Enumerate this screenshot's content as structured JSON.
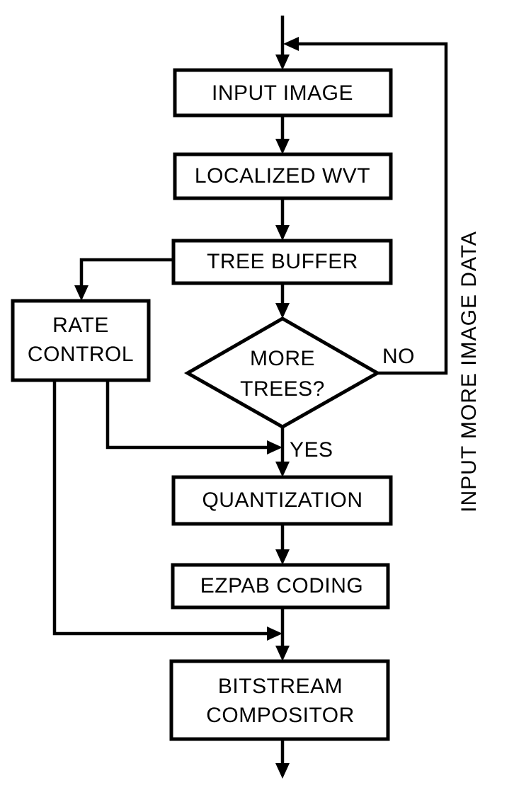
{
  "diagram": {
    "type": "flowchart",
    "title": "Image compression encoder flowchart",
    "orientation": "top-to-bottom",
    "background_color": "#ffffff",
    "line_color": "#000000",
    "nodes": {
      "input_image": {
        "label": "INPUT IMAGE",
        "shape": "rectangle"
      },
      "localized_wvt": {
        "label": "LOCALIZED WVT",
        "shape": "rectangle"
      },
      "tree_buffer": {
        "label": "TREE BUFFER",
        "shape": "rectangle"
      },
      "rate_control_line1": {
        "label": "RATE"
      },
      "rate_control_line2": {
        "label": "CONTROL"
      },
      "more_trees_line1": {
        "label": "MORE"
      },
      "more_trees_line2": {
        "label": "TREES?"
      },
      "quantization": {
        "label": "QUANTIZATION",
        "shape": "rectangle"
      },
      "ezpab_coding": {
        "label": "EZPAB CODING",
        "shape": "rectangle"
      },
      "bitstream_line1": {
        "label": "BITSTREAM"
      },
      "bitstream_line2": {
        "label": "COMPOSITOR"
      }
    },
    "edge_labels": {
      "no_branch": "NO",
      "yes_branch": "YES",
      "feedback_loop": "INPUT MORE IMAGE DATA"
    }
  }
}
